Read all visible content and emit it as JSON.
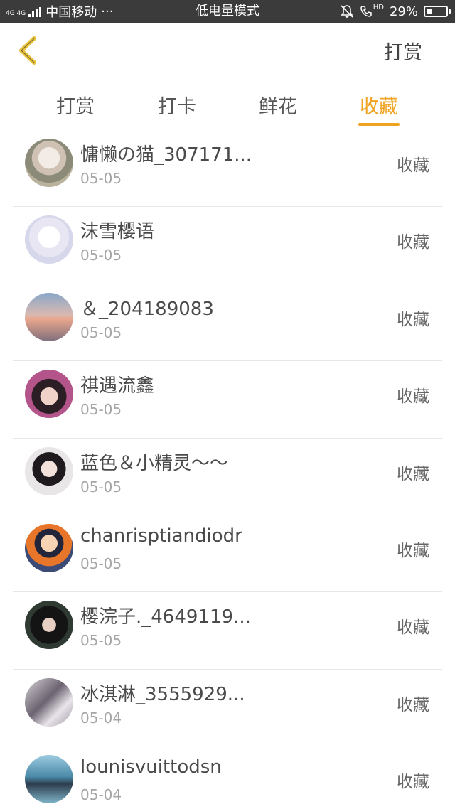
{
  "status_bar": {
    "network": "4G 4G",
    "carrier": "中国移动",
    "dots": "···",
    "mode": "低电量模式",
    "hd": "HD",
    "battery_percent": "29%",
    "battery_level": 0.29,
    "icons": [
      "signal-icon",
      "mute-bell-icon",
      "call-hd-icon",
      "battery-icon"
    ]
  },
  "header": {
    "back_icon": "chevron-left-icon",
    "back_icon_color": "#e8c23a",
    "action_label": "打赏"
  },
  "tabs": [
    {
      "label": "打赏",
      "active": false
    },
    {
      "label": "打卡",
      "active": false
    },
    {
      "label": "鲜花",
      "active": false
    },
    {
      "label": "收藏",
      "active": true
    }
  ],
  "colors": {
    "accent": "#f0a320",
    "status_bar_bg": "#3b3b3b"
  },
  "list": [
    {
      "name": "慵懒の猫_307171...",
      "date": "05-05",
      "action": "收藏"
    },
    {
      "name": "沫雪樱语",
      "date": "05-05",
      "action": "收藏"
    },
    {
      "name": "＆_204189083",
      "date": "05-05",
      "action": "收藏"
    },
    {
      "name": "祺遇流鑫",
      "date": "05-05",
      "action": "收藏"
    },
    {
      "name": "蓝色＆小精灵～～",
      "date": "05-05",
      "action": "收藏"
    },
    {
      "name": "chanrisptiandiodr",
      "date": "05-05",
      "action": "收藏"
    },
    {
      "name": "樱浣子._4649119...",
      "date": "05-05",
      "action": "收藏"
    },
    {
      "name": "冰淇淋_3555929...",
      "date": "05-04",
      "action": "收藏"
    },
    {
      "name": "lounisvuittodsn",
      "date": "05-04",
      "action": "收藏"
    }
  ]
}
